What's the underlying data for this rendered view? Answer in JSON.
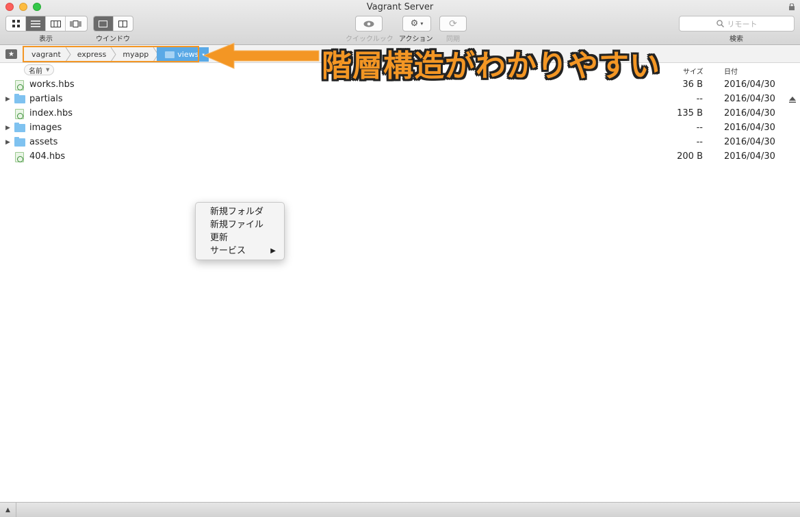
{
  "window": {
    "title": "Vagrant Server"
  },
  "toolbar": {
    "view_label": "表示",
    "window_label": "ウインドウ",
    "quicklook_label": "クイックルック",
    "action_label": "アクション",
    "sync_label": "同期",
    "search_label": "検索",
    "search_placeholder": "リモート"
  },
  "path": {
    "crumbs": [
      "vagrant",
      "express",
      "myapp"
    ],
    "current": "views"
  },
  "columns": {
    "name": "名前",
    "size": "サイズ",
    "date": "日付"
  },
  "files": [
    {
      "name": "works.hbs",
      "size": "36 B",
      "date": "2016/04/30",
      "kind": "file"
    },
    {
      "name": "partials",
      "size": "--",
      "date": "2016/04/30",
      "kind": "folder"
    },
    {
      "name": "index.hbs",
      "size": "135 B",
      "date": "2016/04/30",
      "kind": "file"
    },
    {
      "name": "images",
      "size": "--",
      "date": "2016/04/30",
      "kind": "folder"
    },
    {
      "name": "assets",
      "size": "--",
      "date": "2016/04/30",
      "kind": "folder"
    },
    {
      "name": "404.hbs",
      "size": "200 B",
      "date": "2016/04/30",
      "kind": "file"
    }
  ],
  "context_menu": {
    "items": [
      "新規フォルダ",
      "新規ファイル",
      "更新",
      "サービス"
    ],
    "submenu_arrow": "▶"
  },
  "annotation": {
    "text": "階層構造がわかりやすい",
    "color": "#f39624"
  }
}
